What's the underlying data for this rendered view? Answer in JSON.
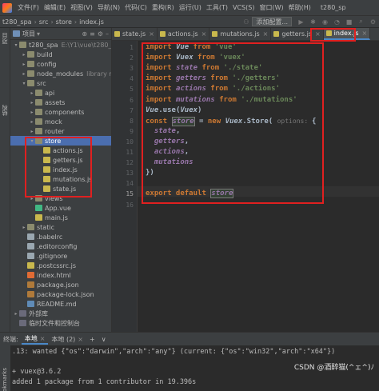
{
  "menubar": {
    "items": [
      "文件(F)",
      "编辑(E)",
      "视图(V)",
      "导航(N)",
      "代码(C)",
      "重构(R)",
      "运行(U)",
      "工具(T)",
      "VCS(S)",
      "窗口(W)",
      "帮助(H)"
    ],
    "project_title": "t280_sp"
  },
  "navbar": {
    "crumbs": [
      "t280_spa",
      "src",
      "store",
      "index.js"
    ],
    "config_button": "添加配置..."
  },
  "left_strip": {
    "project_label": "项目",
    "structure_label": "结构"
  },
  "project_panel": {
    "title": "项目",
    "tree": [
      {
        "indent": 0,
        "arrow": "▾",
        "icon": "folder",
        "label": "t280_spa",
        "extra": "E:\\Y1\\vue\\t280_sp"
      },
      {
        "indent": 1,
        "arrow": "▸",
        "icon": "folder",
        "label": "build",
        "extra": ""
      },
      {
        "indent": 1,
        "arrow": "▸",
        "icon": "folder",
        "label": "config",
        "extra": ""
      },
      {
        "indent": 1,
        "arrow": "▸",
        "icon": "folder",
        "label": "node_modules",
        "extra": "library ro"
      },
      {
        "indent": 1,
        "arrow": "▾",
        "icon": "folder",
        "label": "src",
        "extra": ""
      },
      {
        "indent": 2,
        "arrow": "▸",
        "icon": "folder",
        "label": "api",
        "extra": ""
      },
      {
        "indent": 2,
        "arrow": "▸",
        "icon": "folder",
        "label": "assets",
        "extra": ""
      },
      {
        "indent": 2,
        "arrow": "▸",
        "icon": "folder",
        "label": "components",
        "extra": ""
      },
      {
        "indent": 2,
        "arrow": "▸",
        "icon": "folder",
        "label": "mock",
        "extra": ""
      },
      {
        "indent": 2,
        "arrow": "▸",
        "icon": "folder",
        "label": "router",
        "extra": ""
      },
      {
        "indent": 2,
        "arrow": "▾",
        "icon": "folder",
        "label": "store",
        "extra": "",
        "selected": true
      },
      {
        "indent": 3,
        "arrow": "",
        "icon": "file-js",
        "label": "actions.js",
        "extra": ""
      },
      {
        "indent": 3,
        "arrow": "",
        "icon": "file-js",
        "label": "getters.js",
        "extra": ""
      },
      {
        "indent": 3,
        "arrow": "",
        "icon": "file-js",
        "label": "index.js",
        "extra": ""
      },
      {
        "indent": 3,
        "arrow": "",
        "icon": "file-js",
        "label": "mutations.js",
        "extra": ""
      },
      {
        "indent": 3,
        "arrow": "",
        "icon": "file-js",
        "label": "state.js",
        "extra": ""
      },
      {
        "indent": 2,
        "arrow": "▸",
        "icon": "folder",
        "label": "views",
        "extra": ""
      },
      {
        "indent": 2,
        "arrow": "",
        "icon": "file-vue",
        "label": "App.vue",
        "extra": ""
      },
      {
        "indent": 2,
        "arrow": "",
        "icon": "file-js",
        "label": "main.js",
        "extra": ""
      },
      {
        "indent": 1,
        "arrow": "▸",
        "icon": "folder",
        "label": "static",
        "extra": ""
      },
      {
        "indent": 1,
        "arrow": "",
        "icon": "file-txt",
        "label": ".babelrc",
        "extra": ""
      },
      {
        "indent": 1,
        "arrow": "",
        "icon": "file-txt",
        "label": ".editorconfig",
        "extra": ""
      },
      {
        "indent": 1,
        "arrow": "",
        "icon": "file-txt",
        "label": ".gitignore",
        "extra": ""
      },
      {
        "indent": 1,
        "arrow": "",
        "icon": "file-js",
        "label": ".postcssrc.js",
        "extra": ""
      },
      {
        "indent": 1,
        "arrow": "",
        "icon": "file-html",
        "label": "index.html",
        "extra": ""
      },
      {
        "indent": 1,
        "arrow": "",
        "icon": "file-json",
        "label": "package.json",
        "extra": ""
      },
      {
        "indent": 1,
        "arrow": "",
        "icon": "file-json",
        "label": "package-lock.json",
        "extra": ""
      },
      {
        "indent": 1,
        "arrow": "",
        "icon": "file-md",
        "label": "README.md",
        "extra": ""
      },
      {
        "indent": 0,
        "arrow": "▸",
        "icon": "lib-icon",
        "label": "外部库",
        "extra": ""
      },
      {
        "indent": 0,
        "arrow": "",
        "icon": "lib-icon",
        "label": "临时文件和控制台",
        "extra": ""
      }
    ]
  },
  "tabs": [
    {
      "label": "state.js",
      "active": false
    },
    {
      "label": "actions.js",
      "active": false
    },
    {
      "label": "mutations.js",
      "active": false
    },
    {
      "label": "getters.js",
      "active": false
    },
    {
      "label": "index.js",
      "active": true
    }
  ],
  "editor": {
    "line_numbers": [
      "1",
      "2",
      "3",
      "4",
      "5",
      "6",
      "7",
      "8",
      "9",
      "10",
      "11",
      "12",
      "13",
      "14",
      "15",
      "16"
    ],
    "current_line": "15",
    "code": [
      [
        [
          "kw",
          "import "
        ],
        [
          "cls",
          "Vue "
        ],
        [
          "kw",
          "from "
        ],
        [
          "str",
          "'vue'"
        ]
      ],
      [
        [
          "kw",
          "import "
        ],
        [
          "cls",
          "Vuex "
        ],
        [
          "kw",
          "from "
        ],
        [
          "str",
          "'vuex'"
        ]
      ],
      [
        [
          "kw",
          "import "
        ],
        [
          "var",
          "state "
        ],
        [
          "kw",
          "from "
        ],
        [
          "str",
          "'./state'"
        ]
      ],
      [
        [
          "kw",
          "import "
        ],
        [
          "var",
          "getters "
        ],
        [
          "kw",
          "from "
        ],
        [
          "str",
          "'./getters'"
        ]
      ],
      [
        [
          "kw",
          "import "
        ],
        [
          "var",
          "actions "
        ],
        [
          "kw",
          "from "
        ],
        [
          "str",
          "'./actions'"
        ]
      ],
      [
        [
          "kw",
          "import "
        ],
        [
          "var",
          "mutations "
        ],
        [
          "kw",
          "from "
        ],
        [
          "str",
          "'./mutations'"
        ]
      ],
      [
        [
          "cls",
          "Vue"
        ],
        [
          "plain",
          ".use("
        ],
        [
          "cls",
          "Vuex"
        ],
        [
          "plain",
          ")"
        ]
      ],
      [
        [
          "kw",
          "const "
        ],
        [
          "hl",
          "store"
        ],
        [
          "plain",
          " = "
        ],
        [
          "kw",
          "new "
        ],
        [
          "cls",
          "Vuex"
        ],
        [
          "plain",
          ".Store( "
        ],
        [
          "hint",
          "options: "
        ],
        [
          "plain",
          "{"
        ]
      ],
      [
        [
          "var",
          "  state"
        ],
        [
          "plain",
          ","
        ]
      ],
      [
        [
          "var",
          "  getters"
        ],
        [
          "plain",
          ","
        ]
      ],
      [
        [
          "var",
          "  actions"
        ],
        [
          "plain",
          ","
        ]
      ],
      [
        [
          "var",
          "  mutations"
        ]
      ],
      [
        [
          "plain",
          "})"
        ]
      ],
      [],
      [
        [
          "kw",
          "export default "
        ],
        [
          "hl",
          "store"
        ]
      ],
      []
    ]
  },
  "terminal": {
    "tabs": [
      {
        "label": "终端:",
        "active": false
      },
      {
        "label": "本地",
        "active": true
      },
      {
        "label": "本地 (2)",
        "active": false
      }
    ],
    "lines": [
      ".13: wanted {\"os\":\"darwin\",\"arch\":\"any\"} (current: {\"os\":\"win32\",\"arch\":\"x64\"})",
      "",
      "+ vuex@3.6.2",
      "added 1 package from 1 contributor in 19.396s"
    ],
    "watermark": "CSDN @酒醉猫(^ェ^)ﾉ",
    "strip_label": "Bookmarks"
  }
}
